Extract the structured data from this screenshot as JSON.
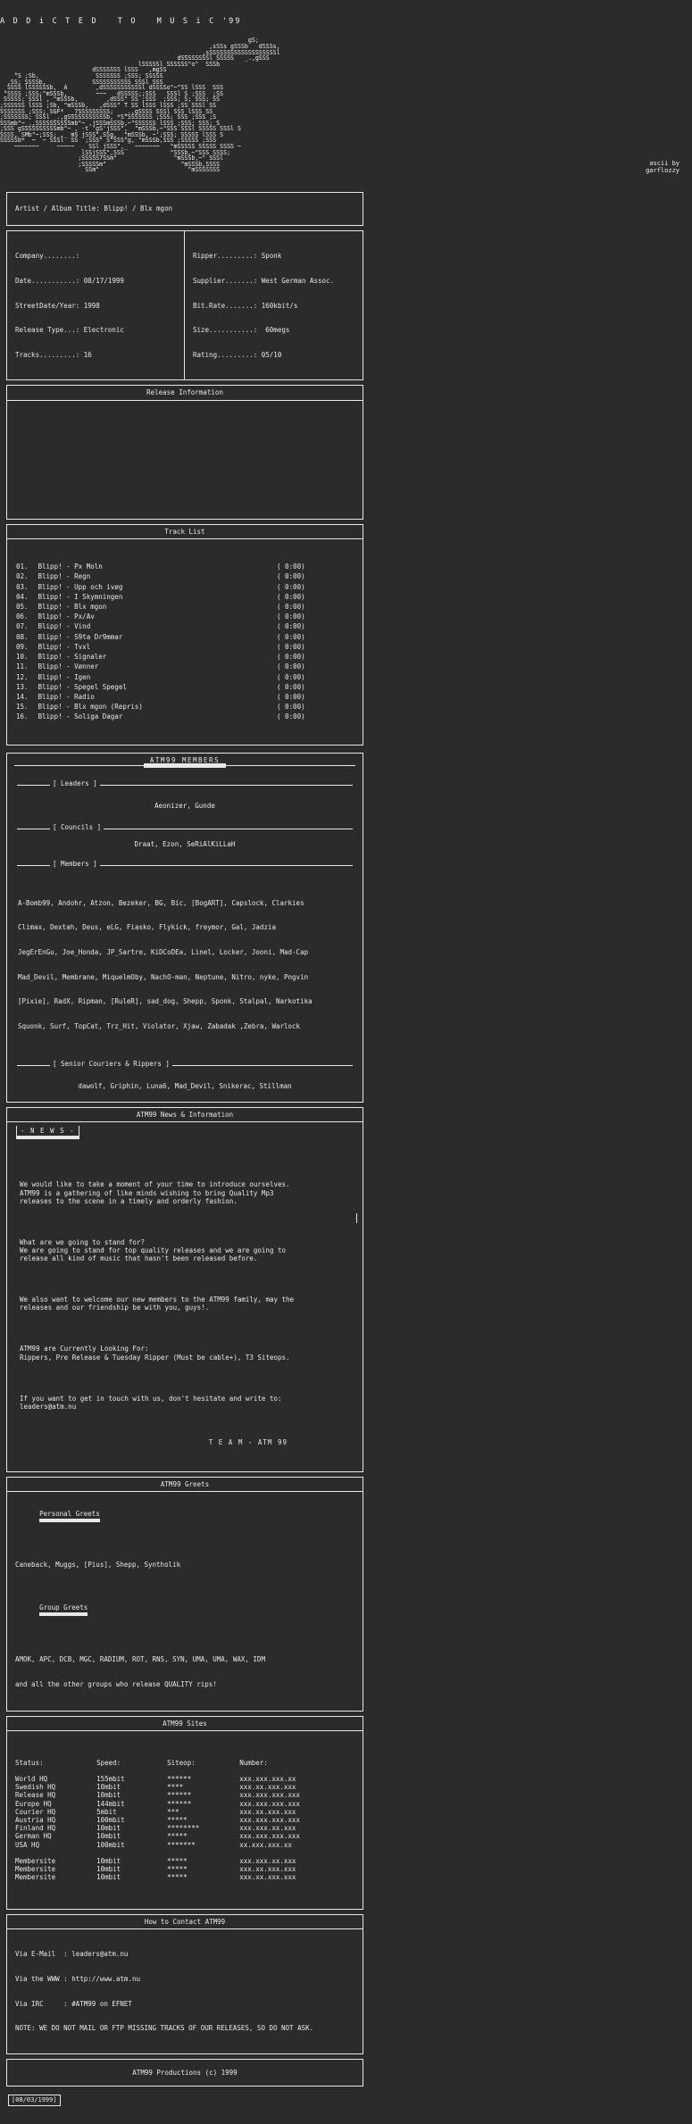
{
  "header": {
    "title_line": "A D D i C T E D   T O   M U S i C '99",
    "credit": "ascii by\ngarflozzy",
    "art": [
      "                                                                      gS;",
      "                                                           ,sSSs gSSSb   dSSSs,",
      "                                                    _    ,sSSSSSSSSSSSSSSSSSSSl",
      "                                                  dSSSSSSSSl SSSSS   _.,gSSS",
      "                                       lSSSSSl SSSSSS\"o\"  SSSb",
      "                          dSSSSSSS lSSS   ,mgSS",
      "    °S ;Sb,                SSSSSSS ;SSS; SSSSS",
      "  ,SS; SSSSb,             SSSSSSSSSSS SSSl SSS",
      "  SSSS lSSSSSSb,  A        ,dSSSSSSSSSSSl dSSSSo\"~\"SS lSSS  SSS",
      " °SSSS ;SSS;\"mSSSb,        ~~~   dSSSSS;;SSS   SSSl S ;SSS  ;SS",
      " SSSSS; SSSl , \"mSSSb,        ,dSSS\" SS ;SSS  ;SSS; S; SSS; SS",
      ";SSSSSS lSSS ;Sb, \"mSSSb,   ,dSSS\" T SS lSSS lSSS ;SS SSSl SS",
      "SSSSSSS ;SSS; SGF*  _7SSSSSSSSS;   _.,gSSSS SSSl SSS lSSS SS",
      ";SSSSSSS; SSSl _.,gSSSSSSSSSSSb, *S°SSSSSSS ;SSS; SSS ;SSS ;S",
      "SSSmb\"~_.,SSSSSSSSSSmb\"~ ,jSSSmSSSb,~\"SSSSSS lSSS ;SSS; SSS; S",
      ";SSS gSSSSSSSSSSmb\"~ , -t 'gS'jSSS\",  \"mSSSb,~\"SSS SSSl SSSSS SSSl S",
      "SSSS, SMb\"~;SSS; ,_ mS jSSS\",SSg,  \"mSSSb, ~';SSS; SSSSS lSSS S",
      "SSSSSb*  ~  ~ SSSl  SS  ;SSS\" S°SSS°g, \"mSSSb,SSS ;SSSSS ;SSS",
      "    ~~~~~~~     ~~~~~    SSl jSSS\",_  ~~~~~~~   \"mSSSSS SSSSS SSSS ~",
      "                       lSSjSSS\",SSS             \"SSSb,~\"SSS SSSS;",
      "                      ;SSSSS7SSm\"                \"mSSSb,~\" SSSl",
      "                      ;SSSSSm\"                     \"mSSSb,SSSS",
      "                        SSm\"                         \"mSSSSSSS"
    ]
  },
  "artist_box": {
    "label": "Artist / Album Title: Blipp! / Blx mgon"
  },
  "info": {
    "left": [
      "Company........:",
      "Date...........: 08/17/1999",
      "StreetDate/Year: 1998",
      "Release Type...: Electronic",
      "Tracks.........: 16"
    ],
    "right": [
      "Ripper.........: Sponk",
      "Supplier.......: West German Assoc.",
      "Bit.Rate.......: 160kbit/s",
      "Size...........:  60megs",
      "Rating.........: 05/10"
    ]
  },
  "release_info": {
    "title": "Release Information",
    "body": ""
  },
  "track_list": {
    "title": "Track List",
    "tracks": [
      {
        "num": "01.",
        "name": "Blipp! - Px Moln",
        "time": "( 0:00)"
      },
      {
        "num": "02.",
        "name": "Blipp! - Regn",
        "time": "( 0:00)"
      },
      {
        "num": "03.",
        "name": "Blipp! - Upp och ivøg",
        "time": "( 0:00)"
      },
      {
        "num": "04.",
        "name": "Blipp! - I Skymningen",
        "time": "( 0:00)"
      },
      {
        "num": "05.",
        "name": "Blipp! - Blx mgon",
        "time": "( 0:00)"
      },
      {
        "num": "06.",
        "name": "Blipp! - Px/Av",
        "time": "( 0:00)"
      },
      {
        "num": "07.",
        "name": "Blipp! - Vind",
        "time": "( 0:00)"
      },
      {
        "num": "08.",
        "name": "Blipp! - S9ta Dr9mmar",
        "time": "( 0:00)"
      },
      {
        "num": "09.",
        "name": "Blipp! - Tvxl",
        "time": "( 0:00)"
      },
      {
        "num": "10.",
        "name": "Blipp! - Signaler",
        "time": "( 0:00)"
      },
      {
        "num": "11.",
        "name": "Blipp! - Vønner",
        "time": "( 0:00)"
      },
      {
        "num": "12.",
        "name": "Blipp! - Igen",
        "time": "( 0:00)"
      },
      {
        "num": "13.",
        "name": "Blipp! - Spegel Spegel",
        "time": "( 0:00)"
      },
      {
        "num": "14.",
        "name": "Blipp! - Radio",
        "time": "( 0:00)"
      },
      {
        "num": "15.",
        "name": "Blipp! - Blx mgon (Repris)",
        "time": "( 0:00)"
      },
      {
        "num": "16.",
        "name": "Blipp! - Soliga Dagar",
        "time": "( 0:00)"
      }
    ]
  },
  "members": {
    "title": "ATM99  MEMBERS",
    "leaders_label": "[ Leaders ]",
    "leaders": "Aeonizer, Gunde",
    "councils_label": "[ Councils ]",
    "councils": "Draat, Ezon, SeRiAlKiLLaH",
    "members_label": "[ Members ]",
    "members_lines": [
      "A-Bomb99, Andohr, Atzon, Bezeker, BG, Bic, [BogART], Capslock, Clarkies",
      "Climax, Dextah, Deus, eLG, Fiasko, Flykick, freymor, Gal, Jadzia",
      "JegErEnGu, Joe_Honda, JP_Sartre, KiDCoDEa, Linel, Locker, Jooni, Mad-Cap",
      "Mad_Devil, Membrane, MiquelmOby, NachO-man, Neptune, Nitro, nyke, Pngvin",
      "[Pixie], RadX, Ripman, [RuleR], sad_dog, Shepp, Sponk, Stalpal, Narkotika",
      "Squonk, Surf, TopCat, Trz_Hit, Violator, Xjaw, Zabadak ,Zebra, Warlock"
    ],
    "couriers_label": "[ Senior Couriers & Rippers ]",
    "couriers": "dawolf, Griphin, Luna6, Mad_Devil, Snikerac, Stillman"
  },
  "news": {
    "title": "ATM99 News & Information",
    "badge": "- N E W S -",
    "paragraphs": [
      "We would like to take a moment of your time to introduce ourselves.\nATM99 is a gathering of like minds wishing to bring Quality Mp3\nreleases to the scene in a timely and orderly fashion.",
      "What are we going to stand for?\nWe are going to stand for top quality releases and we are going to\nrelease all kind of music that hasn't been released before.",
      "We also want to welcome our new members to the ATM99 family, may the\nreleases and our friendship be with you, guys!.",
      "ATM99 are Currently Looking For:\nRippers, Pre Release & Tuesday Ripper (Must be cable+), T3 Siteops.",
      "If you want to get in touch with us, don't hesitate and write to:\nleaders@atm.nu"
    ],
    "signature": "T E A M - ATM 99"
  },
  "greets": {
    "title": "ATM99 Greets",
    "personal_label": "Personal Greets",
    "personal": "Caneback, Muggs, [Pius], Shepp, Syntholik",
    "group_label": "Group Greets",
    "group_line1": "AMOK, APC, DCB, MGC, RADIUM, ROT, RNS, SYN, UMA, UMA, WAX, IDM",
    "group_line2": "and all the other groups who release QUALITY rips!"
  },
  "sites": {
    "title": "ATM99 Sites",
    "columns": [
      "Status:",
      "Speed:",
      "Siteop:",
      "Number:"
    ],
    "rows": [
      {
        "status": "World HQ",
        "speed": "155mbit",
        "siteop": "******",
        "number": "xxx.xxx.xxx.xx"
      },
      {
        "status": "Swedish HQ",
        "speed": "10mbit",
        "siteop": "****",
        "number": "xxx.xx.xxx.xxx"
      },
      {
        "status": "Release HQ",
        "speed": "10mbit",
        "siteop": "******",
        "number": "xxx.xxx.xxx.xxx"
      },
      {
        "status": "Europe HQ",
        "speed": "144mbit",
        "siteop": "******",
        "number": "xxx.xxx.xxx.xxx"
      },
      {
        "status": "Courier HQ",
        "speed": "5mbit",
        "siteop": "***",
        "number": "xxx.xx.xxx.xxx"
      },
      {
        "status": "Austria HQ",
        "speed": "100mbit",
        "siteop": "*****",
        "number": "xxx.xxx.xxx.xxx"
      },
      {
        "status": "Finland HQ",
        "speed": "10mbit",
        "siteop": "********",
        "number": "xxx.xxx.xx.xxx"
      },
      {
        "status": "German HQ",
        "speed": "10mbit",
        "siteop": "*****",
        "number": "xxx.xxx.xxx.xxx"
      },
      {
        "status": "USA HQ",
        "speed": "100mbit",
        "siteop": "*******",
        "number": "xx.xxx.xxx.xx"
      }
    ],
    "member_rows": [
      {
        "status": "Membersite",
        "speed": "10mbit",
        "siteop": "*****",
        "number": "xxx.xxx.xx.xxx"
      },
      {
        "status": "Membersite",
        "speed": "10mbit",
        "siteop": "*****",
        "number": "xxx.xx.xxx.xxx"
      },
      {
        "status": "Membersite",
        "speed": "10mbit",
        "siteop": "*****",
        "number": "xxx.xx.xxx.xxx"
      }
    ]
  },
  "contact": {
    "title": "How to Contact ATM99",
    "lines": [
      "Via E-Mail  : leaders@atm.nu",
      "Via the WWW : http://www.atm.nu",
      "Via IRC     : #ATM99 on EFNET",
      "NOTE: WE DO NOT MAIL OR FTP MISSING TRACKS OF OUR RELEASES, SO DO NOT ASK."
    ]
  },
  "footer": {
    "title": "ATM99 Productions (c) 1999",
    "date": "[08/03/1999]"
  }
}
